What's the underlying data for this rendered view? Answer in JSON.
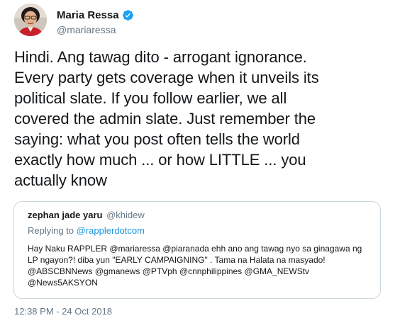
{
  "author": {
    "display_name": "Maria Ressa",
    "handle": "@mariaressa",
    "verified": true,
    "avatar_icon": "user-avatar-photo"
  },
  "tweet": {
    "text": "Hindi. Ang tawag dito - arrogant ignorance.\nEvery party gets coverage when it unveils its\npolitical slate. If you follow earlier, we all\ncovered the admin slate. Just remember the\nsaying: what you post often tells the world\nexactly how much ... or how LITTLE ... you\nactually know",
    "timestamp": "12:38 PM - 24 Oct 2018"
  },
  "quoted_tweet": {
    "display_name": "zephan jade yaru",
    "handle": "@khidew",
    "replying_prefix": "Replying to ",
    "replying_to": "@rapplerdotcom",
    "text": "Hay Naku RAPPLER @mariaressa @piaranada  ehh ano ang tawag nyo sa ginagawa ng\nLP ngayon?! diba yun \"EARLY CAMPAIGNING\" . Tama na Halata na masyado!\n@ABSCBNNews @gmanews @PTVph @cnnphilippines @GMA_NEWStv\n@News5AKSYON"
  },
  "colors": {
    "text_primary": "#14171a",
    "text_secondary": "#657786",
    "link": "#1b95e0",
    "verified_badge": "#1da1f2",
    "border": "#ccd6dd"
  }
}
